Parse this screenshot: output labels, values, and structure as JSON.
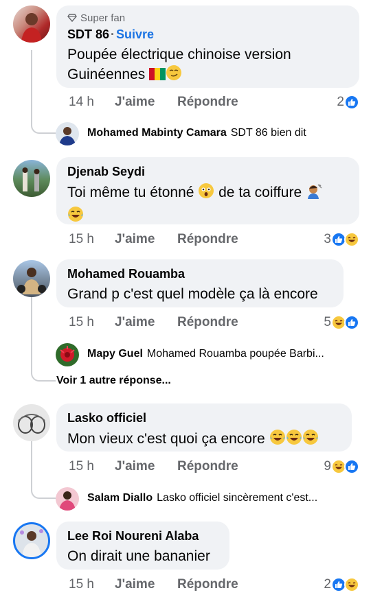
{
  "comments": [
    {
      "badge": "Super fan",
      "author": "SDT 86",
      "follow": "Suivre",
      "text_line1": "Poupée électrique chinoise version",
      "text_line2": "Guinéennes",
      "time": "14 h",
      "like": "J'aime",
      "reply": "Répondre",
      "reaction_count": "2",
      "reactions": [
        "like"
      ],
      "replies": [
        {
          "author": "Mohamed Mabinty Camara",
          "text": "SDT 86 bien dit"
        }
      ]
    },
    {
      "author": "Djenab Seydi",
      "text_line1": "Toi même tu étonné",
      "text_line1b": "de ta coiffure",
      "time": "15 h",
      "like": "J'aime",
      "reply": "Répondre",
      "reaction_count": "3",
      "reactions": [
        "like",
        "haha"
      ]
    },
    {
      "author": "Mohamed Rouamba",
      "text_line1": "Grand p c'est quel modèle ça là encore",
      "time": "15 h",
      "like": "J'aime",
      "reply": "Répondre",
      "reaction_count": "5",
      "reactions": [
        "haha",
        "like"
      ],
      "replies": [
        {
          "author": "Mapy Guel",
          "text": "Mohamed Rouamba poupée Barbi..."
        }
      ],
      "more_replies": "Voir 1 autre réponse..."
    },
    {
      "author": "Lasko officiel",
      "text_line1": "Mon vieux c'est quoi ça encore",
      "time": "15 h",
      "like": "J'aime",
      "reply": "Répondre",
      "reaction_count": "9",
      "reactions": [
        "haha",
        "like"
      ],
      "replies": [
        {
          "author": "Salam Diallo",
          "text": "Lasko officiel sincèrement c'est..."
        }
      ]
    },
    {
      "author": "Lee Roi Noureni Alaba",
      "text_line1": "On dirait une bananier",
      "time": "15 h",
      "like": "J'aime",
      "reply": "Répondre",
      "reaction_count": "2",
      "reactions": [
        "like",
        "haha"
      ]
    }
  ],
  "colors": {
    "bubble": "#f0f2f5",
    "accent": "#1b74e4",
    "muted": "#65676b",
    "like": "#1877f2",
    "haha": "#f7c83e"
  }
}
